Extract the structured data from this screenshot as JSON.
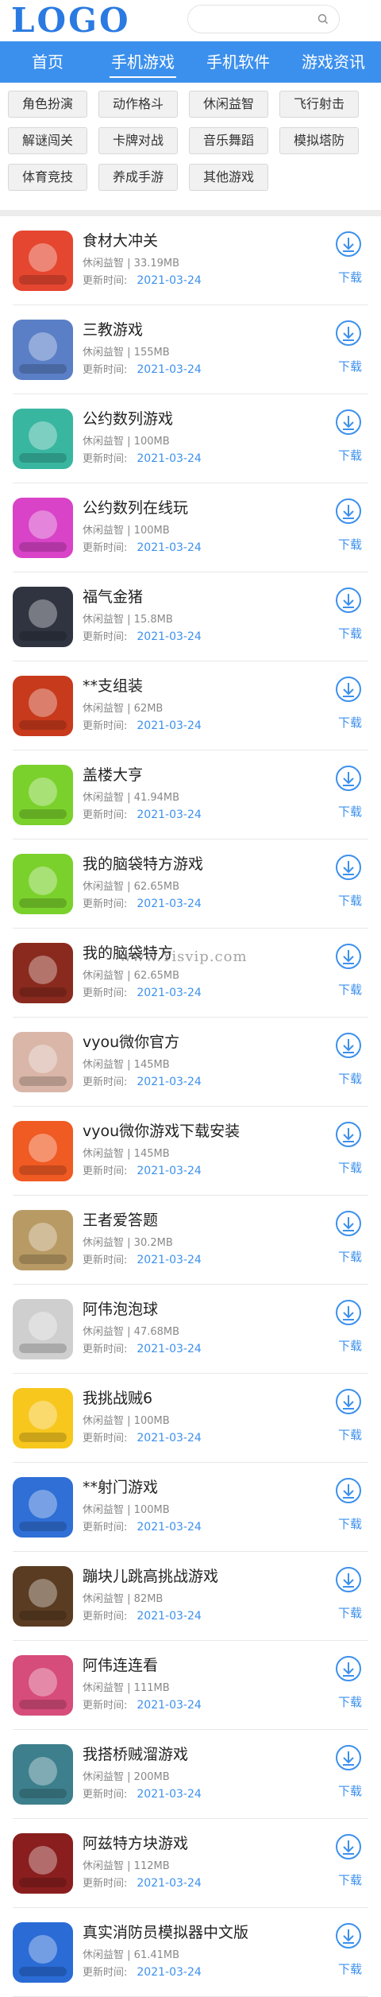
{
  "header": {
    "logo": "LOGO",
    "search_placeholder": ""
  },
  "nav": [
    "首页",
    "手机游戏",
    "手机软件",
    "游戏资讯"
  ],
  "nav_active": 1,
  "categories": [
    "角色扮演",
    "动作格斗",
    "休闲益智",
    "飞行射击",
    "解谜闯关",
    "卡牌对战",
    "音乐舞蹈",
    "模拟塔防",
    "体育竞技",
    "养成手游",
    "其他游戏"
  ],
  "list": {
    "update_label": "更新时间:",
    "download_label": "下载",
    "items": [
      {
        "title": "食材大冲关",
        "category": "休闲益智",
        "size": "33.19MB",
        "date": "2021-03-24",
        "icon_color": "#e5462f"
      },
      {
        "title": "三教游戏",
        "category": "休闲益智",
        "size": "155MB",
        "date": "2021-03-24",
        "icon_color": "#5a7fc6"
      },
      {
        "title": "公约数列游戏",
        "category": "休闲益智",
        "size": "100MB",
        "date": "2021-03-24",
        "icon_color": "#38b6a0"
      },
      {
        "title": "公约数列在线玩",
        "category": "休闲益智",
        "size": "100MB",
        "date": "2021-03-24",
        "icon_color": "#d843c8"
      },
      {
        "title": "福气金猪",
        "category": "休闲益智",
        "size": "15.8MB",
        "date": "2021-03-24",
        "icon_color": "#2f3440"
      },
      {
        "title": "**支组装",
        "category": "休闲益智",
        "size": "62MB",
        "date": "2021-03-24",
        "icon_color": "#c83a1c"
      },
      {
        "title": "盖楼大亨",
        "category": "休闲益智",
        "size": "41.94MB",
        "date": "2021-03-24",
        "icon_color": "#7ad12c"
      },
      {
        "title": "我的脑袋特方游戏",
        "category": "休闲益智",
        "size": "62.65MB",
        "date": "2021-03-24",
        "icon_color": "#7ad12c"
      },
      {
        "title": "我的脑袋特方",
        "category": "休闲益智",
        "size": "62.65MB",
        "date": "2021-03-24",
        "icon_color": "#8a2a1e"
      },
      {
        "title": "vyou微你官方",
        "category": "休闲益智",
        "size": "145MB",
        "date": "2021-03-24",
        "icon_color": "#d9b6a8"
      },
      {
        "title": "vyou微你游戏下载安装",
        "category": "休闲益智",
        "size": "145MB",
        "date": "2021-03-24",
        "icon_color": "#f05a23"
      },
      {
        "title": "王者爱答题",
        "category": "休闲益智",
        "size": "30.2MB",
        "date": "2021-03-24",
        "icon_color": "#b89a64"
      },
      {
        "title": "阿伟泡泡球",
        "category": "休闲益智",
        "size": "47.68MB",
        "date": "2021-03-24",
        "icon_color": "#cfcfcf"
      },
      {
        "title": "我挑战贼6",
        "category": "休闲益智",
        "size": "100MB",
        "date": "2021-03-24",
        "icon_color": "#f7c71e"
      },
      {
        "title": "**射门游戏",
        "category": "休闲益智",
        "size": "100MB",
        "date": "2021-03-24",
        "icon_color": "#2f6fd6"
      },
      {
        "title": "蹦块儿跳高挑战游戏",
        "category": "休闲益智",
        "size": "82MB",
        "date": "2021-03-24",
        "icon_color": "#5a3c22"
      },
      {
        "title": "阿伟连连看",
        "category": "休闲益智",
        "size": "111MB",
        "date": "2021-03-24",
        "icon_color": "#d64c7a"
      },
      {
        "title": "我搭桥贼溜游戏",
        "category": "休闲益智",
        "size": "200MB",
        "date": "2021-03-24",
        "icon_color": "#3d7f8c"
      },
      {
        "title": "阿兹特方块游戏",
        "category": "休闲益智",
        "size": "112MB",
        "date": "2021-03-24",
        "icon_color": "#8a1e1e"
      },
      {
        "title": "真实消防员模拟器中文版",
        "category": "休闲益智",
        "size": "61.41MB",
        "date": "2021-03-24",
        "icon_color": "#2a6bd6"
      }
    ]
  },
  "watermark": "www.Yisvip.com"
}
